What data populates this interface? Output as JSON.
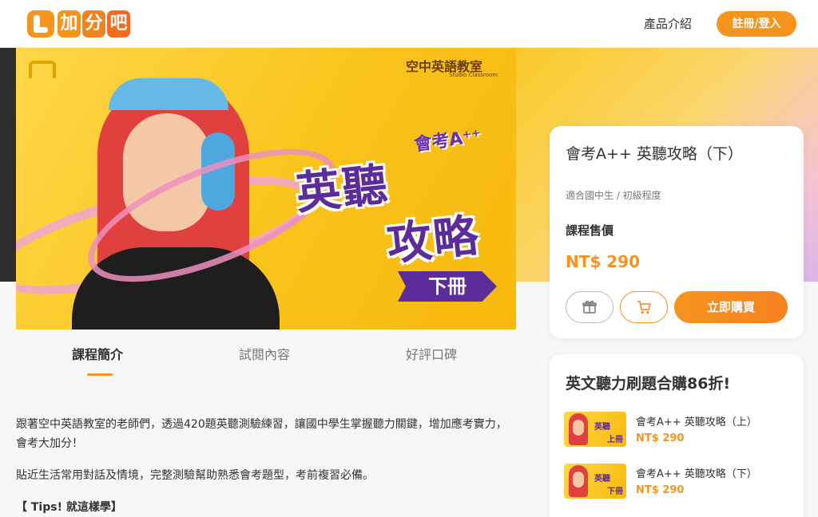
{
  "header": {
    "logo_chars": [
      "加",
      "分",
      "吧"
    ],
    "logo_colors": [
      "#f7941d",
      "#f58220",
      "#f26b21"
    ],
    "nav_products": "產品介紹",
    "login_button": "註冊/登入"
  },
  "banner": {
    "studio_name": "空中英語教室",
    "studio_sub": "Studio Classroom",
    "tag": "會考A⁺⁺",
    "title_line1": "英聽",
    "title_line2": "攻略",
    "volume": "下冊"
  },
  "tabs": [
    {
      "label": "課程簡介",
      "active": true
    },
    {
      "label": "試閱內容",
      "active": false
    },
    {
      "label": "好評口碑",
      "active": false
    }
  ],
  "description": {
    "paragraph1": "跟著空中英語教室的老師們，透過420題英聽測驗練習，讓國中學生掌握聽力關鍵，增加應考實力，會考大加分！",
    "paragraph2": "貼近生活常用對話及情境，完整測驗幫助熟悉會考題型，考前複習必備。",
    "tips": "【 Tips! 就這樣學】"
  },
  "purchase": {
    "title": "會考A++ 英聽攻略（下）",
    "meta": "適合國中生 / 初級程度",
    "price_label": "課程售價",
    "price": "NT$ 290",
    "gift_icon": "gift-icon",
    "cart_icon": "cart-icon",
    "buy_button": "立即購買",
    "accent_color": "#f7941d"
  },
  "bundle": {
    "title": "英文聽力刷題合購86折!",
    "items": [
      {
        "name": "會考A++ 英聽攻略（上）",
        "price": "NT$ 290",
        "thumb_title": "英聽",
        "thumb_vol": "上冊"
      },
      {
        "name": "會考A++ 英聽攻略（下）",
        "price": "NT$ 290",
        "thumb_title": "英聽",
        "thumb_vol": "下冊"
      }
    ]
  }
}
